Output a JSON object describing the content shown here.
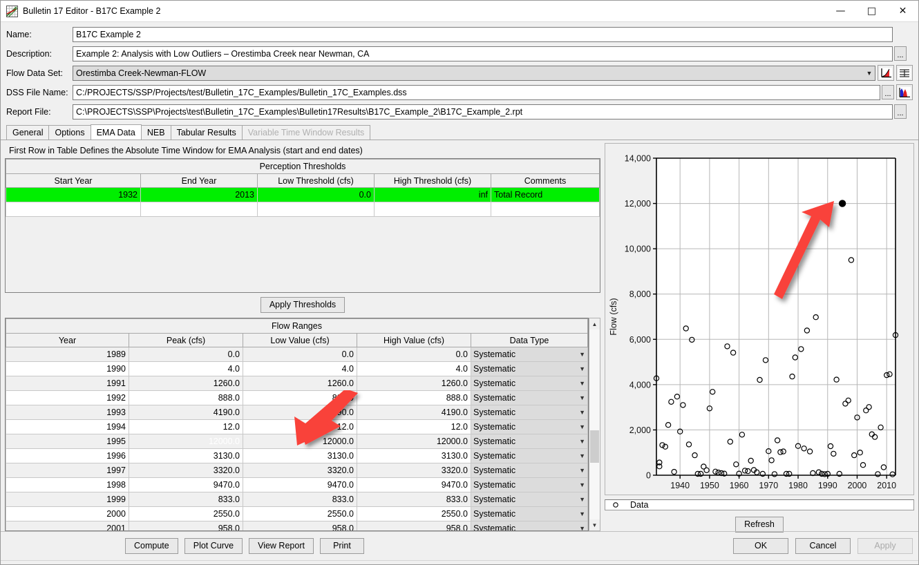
{
  "window": {
    "title": "Bulletin 17 Editor - B17C Example 2",
    "app_icon": "chart-grid-icon",
    "minimize": "minimize-icon",
    "maximize": "maximize-icon",
    "close": "close-icon"
  },
  "form": {
    "name": {
      "label": "Name:",
      "value": "B17C Example 2"
    },
    "description": {
      "label": "Description:",
      "value": "Example 2: Analysis with Low Outliers – Orestimba Creek near Newman, CA",
      "browse": "..."
    },
    "flow_data_set": {
      "label": "Flow Data Set:",
      "value": "Orestimba Creek-Newman-FLOW",
      "plot_icon": "plot-curve-icon",
      "table_icon": "table-icon"
    },
    "dss_file_name": {
      "label": "DSS File Name:",
      "value": "C:/PROJECTS/SSP/Projects/test/Bulletin_17C_Examples/Bulletin_17C_Examples.dss",
      "browse": "...",
      "hist_icon": "histogram-icon"
    },
    "report_file": {
      "label": "Report File:",
      "value": "C:\\PROJECTS\\SSP\\Projects\\test\\Bulletin_17C_Examples\\Bulletin17Results\\B17C_Example_2\\B17C_Example_2.rpt",
      "browse": "..."
    }
  },
  "tabs": [
    {
      "label": "General",
      "active": false,
      "disabled": false
    },
    {
      "label": "Options",
      "active": false,
      "disabled": false
    },
    {
      "label": "EMA Data",
      "active": true,
      "disabled": false
    },
    {
      "label": "NEB",
      "active": false,
      "disabled": false
    },
    {
      "label": "Tabular Results",
      "active": false,
      "disabled": false
    },
    {
      "label": "Variable Time Window Results",
      "active": false,
      "disabled": true
    }
  ],
  "ema": {
    "hint": "First Row in Table Defines the Absolute Time Window for EMA Analysis (start and end dates)",
    "perception": {
      "group_title": "Perception Thresholds",
      "columns": [
        "Start Year",
        "End Year",
        "Low Threshold (cfs)",
        "High Threshold (cfs)",
        "Comments"
      ],
      "rows": [
        {
          "start_year": "1932",
          "end_year": "2013",
          "low": "0.0",
          "high": "inf",
          "comments": "Total Record",
          "highlight": true
        },
        {
          "start_year": "",
          "end_year": "",
          "low": "",
          "high": "",
          "comments": "",
          "highlight": false
        }
      ]
    },
    "apply_thresholds": "Apply Thresholds",
    "flow_ranges": {
      "group_title": "Flow Ranges",
      "columns": [
        "Year",
        "Peak (cfs)",
        "Low Value (cfs)",
        "High Value (cfs)",
        "Data Type"
      ],
      "rows": [
        {
          "year": "1989",
          "peak": "0.0",
          "low": "0.0",
          "high": "0.0",
          "type": "Systematic",
          "selected": false
        },
        {
          "year": "1990",
          "peak": "4.0",
          "low": "4.0",
          "high": "4.0",
          "type": "Systematic",
          "selected": false
        },
        {
          "year": "1991",
          "peak": "1260.0",
          "low": "1260.0",
          "high": "1260.0",
          "type": "Systematic",
          "selected": false
        },
        {
          "year": "1992",
          "peak": "888.0",
          "low": "888.0",
          "high": "888.0",
          "type": "Systematic",
          "selected": false
        },
        {
          "year": "1993",
          "peak": "4190.0",
          "low": "4190.0",
          "high": "4190.0",
          "type": "Systematic",
          "selected": false
        },
        {
          "year": "1994",
          "peak": "12.0",
          "low": "12.0",
          "high": "12.0",
          "type": "Systematic",
          "selected": false
        },
        {
          "year": "1995",
          "peak": "12000.0",
          "low": "12000.0",
          "high": "12000.0",
          "type": "Systematic",
          "selected": true
        },
        {
          "year": "1996",
          "peak": "3130.0",
          "low": "3130.0",
          "high": "3130.0",
          "type": "Systematic",
          "selected": false
        },
        {
          "year": "1997",
          "peak": "3320.0",
          "low": "3320.0",
          "high": "3320.0",
          "type": "Systematic",
          "selected": false
        },
        {
          "year": "1998",
          "peak": "9470.0",
          "low": "9470.0",
          "high": "9470.0",
          "type": "Systematic",
          "selected": false
        },
        {
          "year": "1999",
          "peak": "833.0",
          "low": "833.0",
          "high": "833.0",
          "type": "Systematic",
          "selected": false
        },
        {
          "year": "2000",
          "peak": "2550.0",
          "low": "2550.0",
          "high": "2550.0",
          "type": "Systematic",
          "selected": false
        },
        {
          "year": "2001",
          "peak": "958.0",
          "low": "958.0",
          "high": "958.0",
          "type": "Systematic",
          "selected": false
        }
      ]
    }
  },
  "chart_data": {
    "type": "scatter",
    "title": "",
    "xlabel": "",
    "ylabel": "Flow (cfs)",
    "xlim": [
      1932,
      2013
    ],
    "ylim": [
      0,
      14000
    ],
    "xticks": [
      1940,
      1950,
      1960,
      1970,
      1980,
      1990,
      2000,
      2010
    ],
    "yticks": [
      0,
      2000,
      4000,
      6000,
      8000,
      10000,
      12000,
      14000
    ],
    "ytick_labels": [
      "0",
      "2,000",
      "4,000",
      "6,000",
      "8,000",
      "10,000",
      "12,000",
      "14,000"
    ],
    "grid": true,
    "legend_position": "bottom",
    "series": [
      {
        "name": "Data",
        "marker": "open-circle",
        "color": "#000000",
        "points": [
          [
            1932,
            4280
          ],
          [
            1933,
            390
          ],
          [
            1933,
            560
          ],
          [
            1934,
            1330
          ],
          [
            1935,
            1260
          ],
          [
            1936,
            2220
          ],
          [
            1937,
            3240
          ],
          [
            1938,
            150
          ],
          [
            1939,
            3470
          ],
          [
            1940,
            1930
          ],
          [
            1941,
            3100
          ],
          [
            1942,
            6480
          ],
          [
            1943,
            1360
          ],
          [
            1944,
            5980
          ],
          [
            1945,
            880
          ],
          [
            1946,
            60
          ],
          [
            1947,
            60
          ],
          [
            1948,
            380
          ],
          [
            1949,
            220
          ],
          [
            1950,
            2950
          ],
          [
            1951,
            3680
          ],
          [
            1952,
            160
          ],
          [
            1953,
            120
          ],
          [
            1954,
            90
          ],
          [
            1955,
            70
          ],
          [
            1956,
            5690
          ],
          [
            1957,
            1480
          ],
          [
            1958,
            5410
          ],
          [
            1959,
            480
          ],
          [
            1960,
            70
          ],
          [
            1961,
            1790
          ],
          [
            1962,
            200
          ],
          [
            1963,
            180
          ],
          [
            1964,
            640
          ],
          [
            1965,
            230
          ],
          [
            1966,
            130
          ],
          [
            1967,
            4210
          ],
          [
            1968,
            60
          ],
          [
            1969,
            5080
          ],
          [
            1970,
            1060
          ],
          [
            1971,
            660
          ],
          [
            1972,
            50
          ],
          [
            1973,
            1540
          ],
          [
            1974,
            1020
          ],
          [
            1975,
            1050
          ],
          [
            1976,
            60
          ],
          [
            1977,
            60
          ],
          [
            1978,
            4360
          ],
          [
            1979,
            5200
          ],
          [
            1980,
            1290
          ],
          [
            1981,
            5570
          ],
          [
            1982,
            1180
          ],
          [
            1983,
            6390
          ],
          [
            1984,
            1050
          ],
          [
            1985,
            90
          ],
          [
            1986,
            6980
          ],
          [
            1987,
            130
          ],
          [
            1988,
            60
          ],
          [
            1989,
            50
          ],
          [
            1990,
            60
          ],
          [
            1991,
            1280
          ],
          [
            1992,
            950
          ],
          [
            1993,
            4220
          ],
          [
            1994,
            60
          ],
          [
            1995,
            12000
          ],
          [
            1996,
            3160
          ],
          [
            1997,
            3300
          ],
          [
            1998,
            9500
          ],
          [
            1999,
            880
          ],
          [
            2000,
            2550
          ],
          [
            2001,
            1000
          ],
          [
            2002,
            450
          ],
          [
            2003,
            2860
          ],
          [
            2004,
            3010
          ],
          [
            2005,
            1810
          ],
          [
            2006,
            1690
          ],
          [
            2007,
            50
          ],
          [
            2008,
            2110
          ],
          [
            2009,
            350
          ],
          [
            2010,
            4420
          ],
          [
            2011,
            4460
          ],
          [
            2012,
            40
          ],
          [
            2013,
            6190
          ]
        ],
        "highlighted_point": {
          "x": 1995,
          "y": 12000,
          "marker": "filled-circle"
        }
      }
    ],
    "legend": [
      {
        "label": "Data",
        "marker": "open-circle"
      }
    ]
  },
  "chart_panel": {
    "refresh": "Refresh",
    "legend_label": "Data"
  },
  "bottom_buttons": {
    "compute": "Compute",
    "plot_curve": "Plot Curve",
    "view_report": "View Report",
    "print": "Print",
    "ok": "OK",
    "cancel": "Cancel",
    "apply": "Apply"
  },
  "annotations": [
    {
      "name": "arrow-to-peak-cell",
      "color": "#f9423a"
    },
    {
      "name": "arrow-to-chart-point",
      "color": "#f9423a"
    }
  ]
}
